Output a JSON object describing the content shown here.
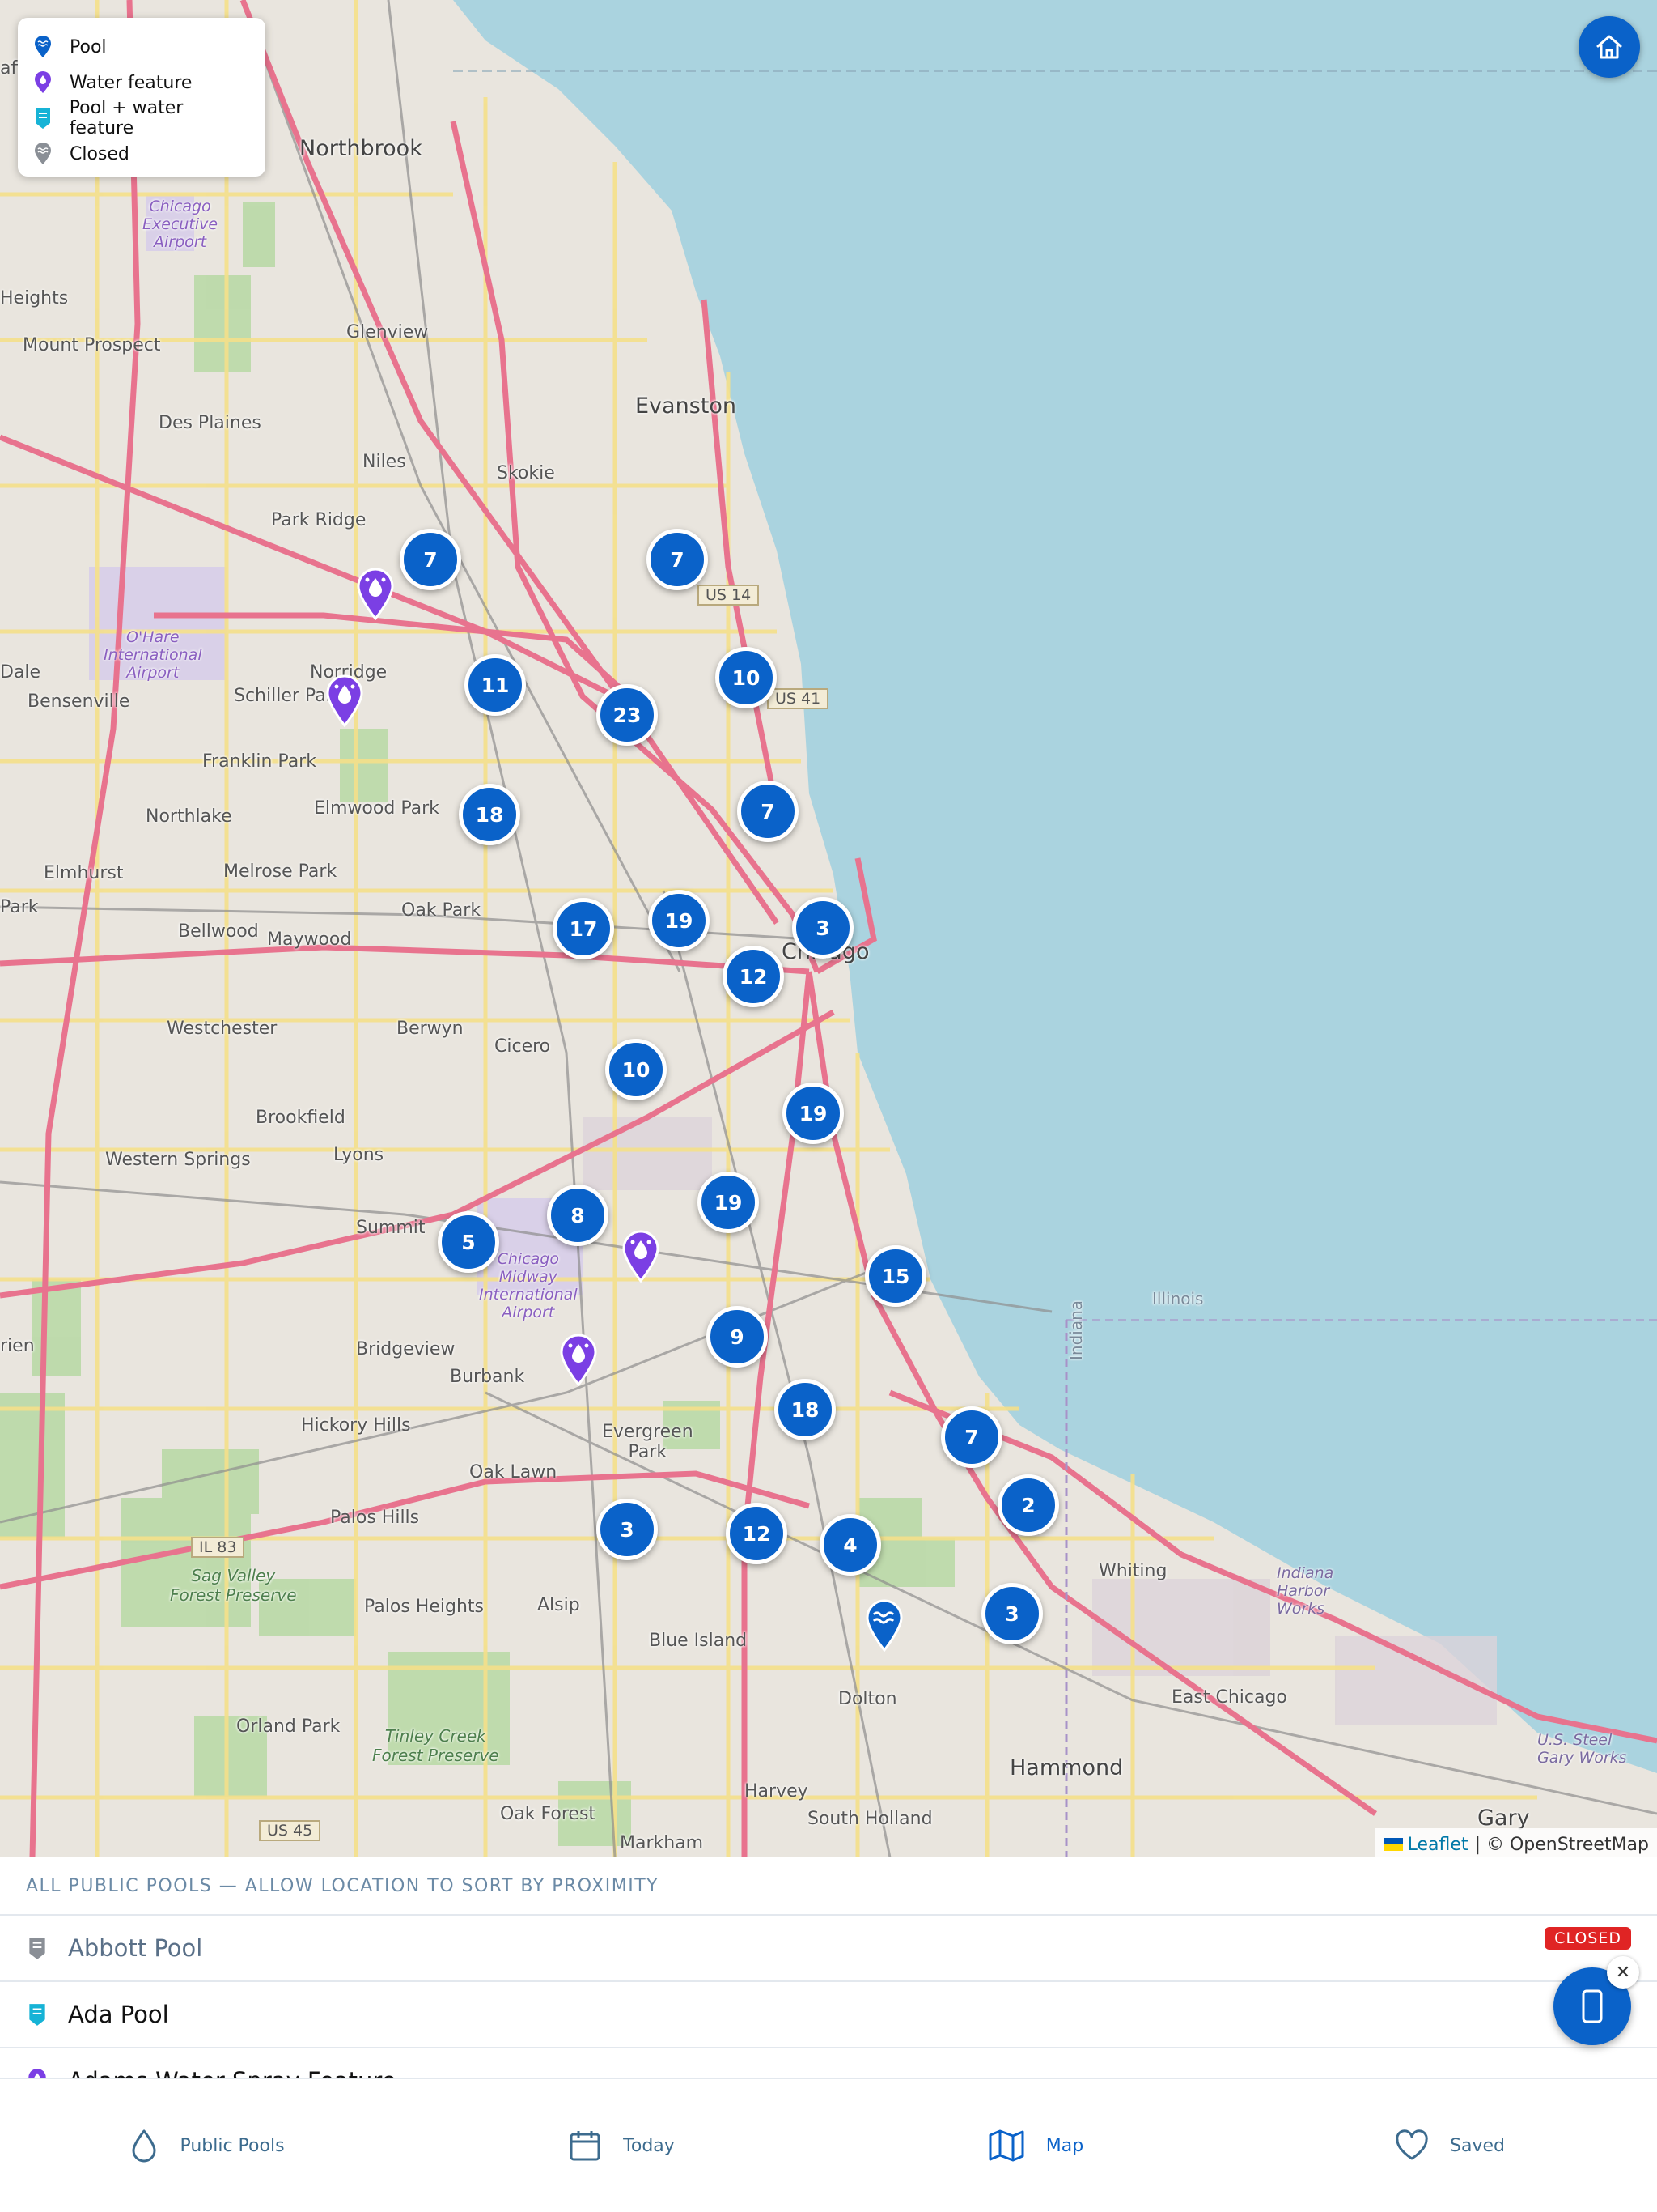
{
  "legend": {
    "items": [
      {
        "label": "Pool",
        "icon": "pool-pin-icon",
        "color": "#0a62c9"
      },
      {
        "label": "Water feature",
        "icon": "water-feature-pin-icon",
        "color": "#7b3fe4"
      },
      {
        "label": "Pool + water feature",
        "icon": "pool-water-feature-pin-icon",
        "color": "#16b3d6"
      },
      {
        "label": "Closed",
        "icon": "closed-pin-icon",
        "color": "#8a8f96"
      }
    ]
  },
  "map": {
    "places": {
      "northbrook": "Northbrook",
      "glenview": "Glenview",
      "evanston": "Evanston",
      "mount_prospect": "Mount Prospect",
      "des_plaines": "Des Plaines",
      "niles": "Niles",
      "skokie": "Skokie",
      "park_ridge": "Park Ridge",
      "norridge": "Norridge",
      "schiller_park": "Schiller Park",
      "bensenville": "Bensenville",
      "franklin_park": "Franklin Park",
      "elmwood_park": "Elmwood Park",
      "northlake": "Northlake",
      "elmhurst": "Elmhurst",
      "melrose_park": "Melrose Park",
      "bellwood": "Bellwood",
      "maywood": "Maywood",
      "oak_park": "Oak Park",
      "chicago": "Chicago",
      "westchester": "Westchester",
      "berwyn": "Berwyn",
      "cicero": "Cicero",
      "brookfield": "Brookfield",
      "lyons": "Lyons",
      "western_springs": "Western Springs",
      "summit": "Summit",
      "bridgeview": "Bridgeview",
      "burbank": "Burbank",
      "hickory_hills": "Hickory Hills",
      "evergreen_park": "Evergreen\nPark",
      "oak_lawn": "Oak Lawn",
      "palos_hills": "Palos Hills",
      "palos_heights": "Palos Heights",
      "alsip": "Alsip",
      "blue_island": "Blue Island",
      "dolton": "Dolton",
      "orland_park": "Orland Park",
      "harvey": "Harvey",
      "south_holland": "South Holland",
      "oak_forest": "Oak Forest",
      "markham": "Markham",
      "hammond": "Hammond",
      "whiting": "Whiting",
      "east_chicago": "East Chicago",
      "gary": "Gary",
      "indiana_harbor": "Indiana\nHarbor\nWorks",
      "us_steel": "U.S. Steel\nGary Works",
      "illinois": "Illinois",
      "indiana": "Indiana",
      "heights": "Heights",
      "dale": "Dale",
      "park": "Park",
      "rien": "rien",
      "aff": "aff",
      "ohare": "O'Hare\nInternational\nAirport",
      "midway": "Chicago\nMidway\nInternational\nAirport",
      "executive": "Chicago\nExecutive\nAirport",
      "sag_valley": "Sag Valley\nForest Preserve",
      "tinley_creek": "Tinley Creek\nForest Preserve"
    },
    "shields": {
      "us14": "US 14",
      "us41": "US 41",
      "il83": "IL 83",
      "us45": "US 45"
    },
    "clusters": [
      {
        "count": "7",
        "name": "cluster-park-ridge"
      },
      {
        "count": "7",
        "name": "cluster-evanston-south"
      },
      {
        "count": "11",
        "name": "cluster-jefferson-park"
      },
      {
        "count": "23",
        "name": "cluster-north-center"
      },
      {
        "count": "10",
        "name": "cluster-edgewater"
      },
      {
        "count": "18",
        "name": "cluster-belmont-cragin"
      },
      {
        "count": "7",
        "name": "cluster-lincoln-park"
      },
      {
        "count": "17",
        "name": "cluster-austin"
      },
      {
        "count": "19",
        "name": "cluster-west-town"
      },
      {
        "count": "3",
        "name": "cluster-downtown"
      },
      {
        "count": "12",
        "name": "cluster-near-west"
      },
      {
        "count": "10",
        "name": "cluster-little-village"
      },
      {
        "count": "19",
        "name": "cluster-bronzeville"
      },
      {
        "count": "19",
        "name": "cluster-englewood-north"
      },
      {
        "count": "8",
        "name": "cluster-archer-heights"
      },
      {
        "count": "5",
        "name": "cluster-summit"
      },
      {
        "count": "15",
        "name": "cluster-south-shore"
      },
      {
        "count": "9",
        "name": "cluster-chatham"
      },
      {
        "count": "18",
        "name": "cluster-roseland"
      },
      {
        "count": "7",
        "name": "cluster-south-chicago"
      },
      {
        "count": "2",
        "name": "cluster-hegewisch"
      },
      {
        "count": "3",
        "name": "cluster-oak-lawn-south"
      },
      {
        "count": "12",
        "name": "cluster-morgan-park"
      },
      {
        "count": "4",
        "name": "cluster-pullman"
      },
      {
        "count": "3",
        "name": "cluster-calumet-city"
      }
    ],
    "attribution": {
      "leaflet": "Leaflet",
      "rest": "| © OpenStreetMap"
    }
  },
  "list": {
    "header": "ALL PUBLIC POOLS — ALLOW LOCATION TO SORT BY PROXIMITY",
    "items": [
      {
        "name": "Abbott Pool",
        "status": "CLOSED"
      },
      {
        "name": "Ada Pool"
      },
      {
        "name": "Adams Water Spray Feature"
      }
    ]
  },
  "nav": {
    "items": [
      {
        "label": "Public Pools"
      },
      {
        "label": "Today"
      },
      {
        "label": "Map"
      },
      {
        "label": "Saved"
      }
    ]
  },
  "fab": {
    "close": "✕"
  },
  "colors": {
    "accent": "#0a62c9",
    "closed_badge": "#e02424",
    "water": "#aad3df"
  }
}
